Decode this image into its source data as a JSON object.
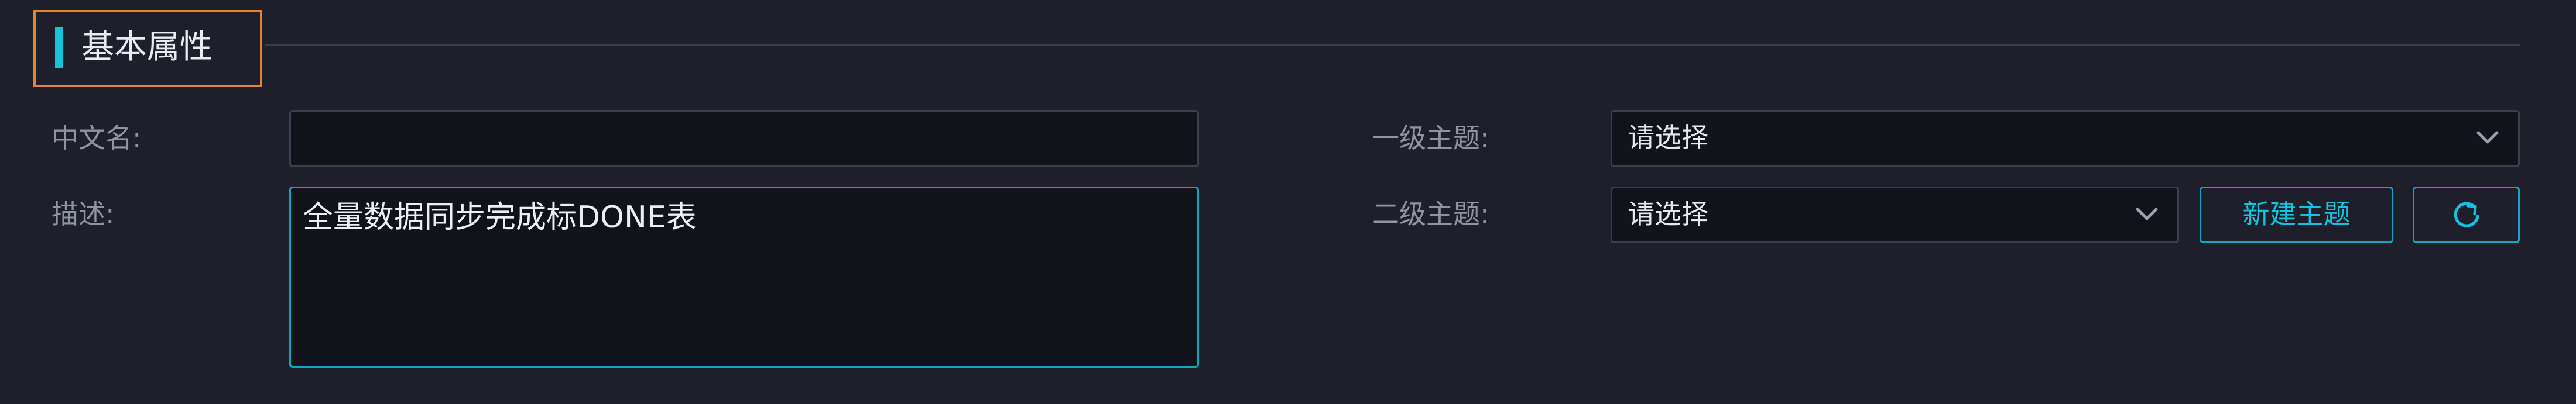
{
  "section": {
    "title": "基本属性"
  },
  "form": {
    "chinese_name": {
      "label": "中文名:",
      "value": ""
    },
    "description": {
      "label": "描述:",
      "value": "全量数据同步完成标DONE表"
    },
    "level1_topic": {
      "label": "一级主题:",
      "selected": "请选择"
    },
    "level2_topic": {
      "label": "二级主题:",
      "selected": "请选择"
    },
    "new_topic_button": "新建主题",
    "refresh_icon": "refresh-icon",
    "chevron_icon": "chevron-down-icon"
  },
  "colors": {
    "background": "#1e1f2b",
    "accent": "#14c3e0",
    "highlight_border": "#e3852e",
    "input_background": "#11131b"
  }
}
